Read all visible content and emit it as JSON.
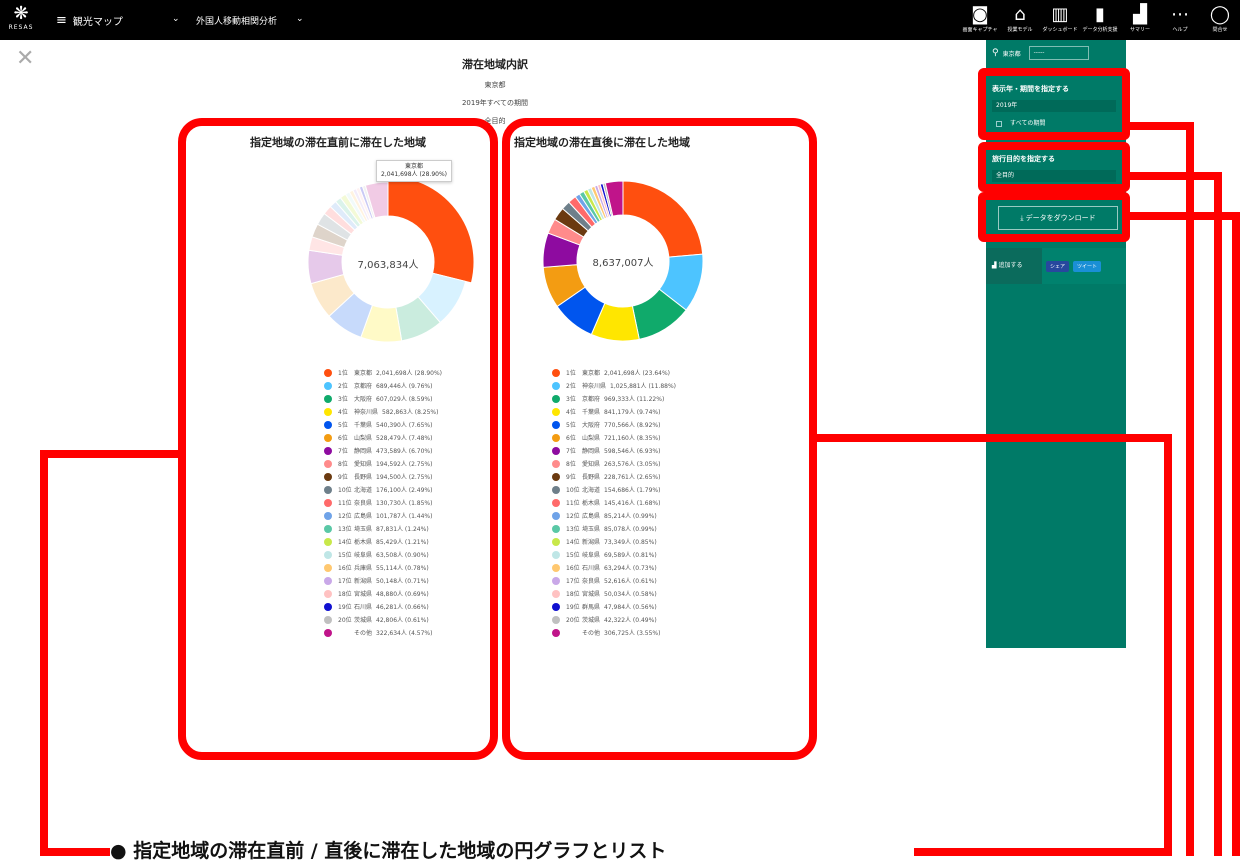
{
  "app": {
    "logo_text": "RESAS",
    "menu_label": "観光マップ",
    "submenu_label": "外国人移動相関分析"
  },
  "toolbar": [
    {
      "icon": "camera-icon",
      "label": "画面キャプチャ"
    },
    {
      "icon": "bank-icon",
      "label": "授業モデル"
    },
    {
      "icon": "dashboard-icon",
      "label": "ダッシュボード"
    },
    {
      "icon": "chart-icon",
      "label": "データ分析支援"
    },
    {
      "icon": "summary-icon",
      "label": "サマリー"
    },
    {
      "icon": "more-icon",
      "label": "ヘルプ"
    },
    {
      "icon": "chat-icon",
      "label": "問合せ"
    }
  ],
  "header": {
    "title": "滞在地域内訳",
    "pref": "東京都",
    "period": "2019年すべての期間",
    "purpose": "全目的"
  },
  "left": {
    "title": "指定地域の滞在直前に滞在した地域",
    "total": "7,063,834人",
    "tooltip": {
      "name": "東京都",
      "value": "2,041,698人 (28.90%)"
    },
    "items": [
      {
        "rank": "1位",
        "pref": "東京都",
        "val": "2,041,698人 (28.90%)",
        "color": "#ff4f0f"
      },
      {
        "rank": "2位",
        "pref": "京都府",
        "val": "689,446人 (9.76%)",
        "color": "#4dc4ff"
      },
      {
        "rank": "3位",
        "pref": "大阪府",
        "val": "607,029人 (8.59%)",
        "color": "#10aa6b"
      },
      {
        "rank": "4位",
        "pref": "神奈川県",
        "val": "582,863人 (8.25%)",
        "color": "#ffe600"
      },
      {
        "rank": "5位",
        "pref": "千葉県",
        "val": "540,390人 (7.65%)",
        "color": "#0055ee"
      },
      {
        "rank": "6位",
        "pref": "山梨県",
        "val": "528,479人 (7.48%)",
        "color": "#f39c12"
      },
      {
        "rank": "7位",
        "pref": "静岡県",
        "val": "473,589人 (6.70%)",
        "color": "#8e0ba0"
      },
      {
        "rank": "8位",
        "pref": "愛知県",
        "val": "194,592人 (2.75%)",
        "color": "#ff8b8b"
      },
      {
        "rank": "9位",
        "pref": "長野県",
        "val": "194,500人 (2.75%)",
        "color": "#6b3a10"
      },
      {
        "rank": "10位",
        "pref": "北海道",
        "val": "176,100人 (2.49%)",
        "color": "#6e7f8a"
      },
      {
        "rank": "11位",
        "pref": "奈良県",
        "val": "130,730人 (1.85%)",
        "color": "#ff6a6a"
      },
      {
        "rank": "12位",
        "pref": "広島県",
        "val": "101,787人 (1.44%)",
        "color": "#6fa3e8"
      },
      {
        "rank": "13位",
        "pref": "埼玉県",
        "val": "87,831人 (1.24%)",
        "color": "#5ac8a6"
      },
      {
        "rank": "14位",
        "pref": "栃木県",
        "val": "85,429人 (1.21%)",
        "color": "#c8e84a"
      },
      {
        "rank": "15位",
        "pref": "岐阜県",
        "val": "63,508人 (0.90%)",
        "color": "#bfe6e6"
      },
      {
        "rank": "16位",
        "pref": "兵庫県",
        "val": "55,114人 (0.78%)",
        "color": "#ffc870"
      },
      {
        "rank": "17位",
        "pref": "新潟県",
        "val": "50,148人 (0.71%)",
        "color": "#c9a8e8"
      },
      {
        "rank": "18位",
        "pref": "宮城県",
        "val": "48,880人 (0.69%)",
        "color": "#ffc2c2"
      },
      {
        "rank": "19位",
        "pref": "石川県",
        "val": "46,281人 (0.66%)",
        "color": "#1010d0"
      },
      {
        "rank": "20位",
        "pref": "茨城県",
        "val": "42,806人 (0.61%)",
        "color": "#c0c0c0"
      },
      {
        "rank": "",
        "pref": "その他",
        "val": "322,634人 (4.57%)",
        "color": "#c0148a"
      }
    ]
  },
  "right": {
    "title": "指定地域の滞在直後に滞在した地域",
    "total": "8,637,007人",
    "items": [
      {
        "rank": "1位",
        "pref": "東京都",
        "val": "2,041,698人 (23.64%)",
        "color": "#ff4f0f"
      },
      {
        "rank": "2位",
        "pref": "神奈川県",
        "val": "1,025,881人 (11.88%)",
        "color": "#4dc4ff"
      },
      {
        "rank": "3位",
        "pref": "京都府",
        "val": "969,333人 (11.22%)",
        "color": "#10aa6b"
      },
      {
        "rank": "4位",
        "pref": "千葉県",
        "val": "841,179人 (9.74%)",
        "color": "#ffe600"
      },
      {
        "rank": "5位",
        "pref": "大阪府",
        "val": "770,566人 (8.92%)",
        "color": "#0055ee"
      },
      {
        "rank": "6位",
        "pref": "山梨県",
        "val": "721,160人 (8.35%)",
        "color": "#f39c12"
      },
      {
        "rank": "7位",
        "pref": "静岡県",
        "val": "598,546人 (6.93%)",
        "color": "#8e0ba0"
      },
      {
        "rank": "8位",
        "pref": "愛知県",
        "val": "263,576人 (3.05%)",
        "color": "#ff8b8b"
      },
      {
        "rank": "9位",
        "pref": "長野県",
        "val": "228,761人 (2.65%)",
        "color": "#6b3a10"
      },
      {
        "rank": "10位",
        "pref": "北海道",
        "val": "154,686人 (1.79%)",
        "color": "#6e7f8a"
      },
      {
        "rank": "11位",
        "pref": "栃木県",
        "val": "145,416人 (1.68%)",
        "color": "#ff6a6a"
      },
      {
        "rank": "12位",
        "pref": "広島県",
        "val": "85,214人 (0.99%)",
        "color": "#6fa3e8"
      },
      {
        "rank": "13位",
        "pref": "埼玉県",
        "val": "85,078人 (0.99%)",
        "color": "#5ac8a6"
      },
      {
        "rank": "14位",
        "pref": "新潟県",
        "val": "73,349人 (0.85%)",
        "color": "#c8e84a"
      },
      {
        "rank": "15位",
        "pref": "岐阜県",
        "val": "69,589人 (0.81%)",
        "color": "#bfe6e6"
      },
      {
        "rank": "16位",
        "pref": "石川県",
        "val": "63,294人 (0.73%)",
        "color": "#ffc870"
      },
      {
        "rank": "17位",
        "pref": "奈良県",
        "val": "52,616人 (0.61%)",
        "color": "#c9a8e8"
      },
      {
        "rank": "18位",
        "pref": "宮城県",
        "val": "50,034人 (0.58%)",
        "color": "#ffc2c2"
      },
      {
        "rank": "19位",
        "pref": "群馬県",
        "val": "47,984人 (0.56%)",
        "color": "#1010d0"
      },
      {
        "rank": "20位",
        "pref": "茨城県",
        "val": "42,322人 (0.49%)",
        "color": "#c0c0c0"
      },
      {
        "rank": "",
        "pref": "その他",
        "val": "306,725人 (3.55%)",
        "color": "#c0148a"
      }
    ]
  },
  "sidebar": {
    "pref": "東京都",
    "city": "-----",
    "year_header": "表示年・期間を指定する",
    "year": "2019年",
    "period": "すべての期間",
    "purpose_header": "旅行目的を指定する",
    "purpose": "全目的",
    "download": "データをダウンロード",
    "add": "追加する",
    "share": "シェア",
    "tweet": "ツイート"
  },
  "annotation": "● 指定地域の滞在直前 / 直後に滞在した地域の円グラフとリスト",
  "chart_data": [
    {
      "type": "pie",
      "title": "指定地域の滞在直前に滞在した地域",
      "total": "7,063,834人",
      "categories": [
        "東京都",
        "京都府",
        "大阪府",
        "神奈川県",
        "千葉県",
        "山梨県",
        "静岡県",
        "愛知県",
        "長野県",
        "北海道",
        "奈良県",
        "広島県",
        "埼玉県",
        "栃木県",
        "岐阜県",
        "兵庫県",
        "新潟県",
        "宮城県",
        "石川県",
        "茨城県",
        "その他"
      ],
      "values": [
        28.9,
        9.76,
        8.59,
        8.25,
        7.65,
        7.48,
        6.7,
        2.75,
        2.75,
        2.49,
        1.85,
        1.44,
        1.24,
        1.21,
        0.9,
        0.78,
        0.71,
        0.69,
        0.66,
        0.61,
        4.57
      ],
      "highlight": 0
    },
    {
      "type": "pie",
      "title": "指定地域の滞在直後に滞在した地域",
      "total": "8,637,007人",
      "categories": [
        "東京都",
        "神奈川県",
        "京都府",
        "千葉県",
        "大阪府",
        "山梨県",
        "静岡県",
        "愛知県",
        "長野県",
        "北海道",
        "栃木県",
        "広島県",
        "埼玉県",
        "新潟県",
        "岐阜県",
        "石川県",
        "奈良県",
        "宮城県",
        "群馬県",
        "茨城県",
        "その他"
      ],
      "values": [
        23.64,
        11.88,
        11.22,
        9.74,
        8.92,
        8.35,
        6.93,
        3.05,
        2.65,
        1.79,
        1.68,
        0.99,
        0.99,
        0.85,
        0.81,
        0.73,
        0.61,
        0.58,
        0.56,
        0.49,
        3.55
      ],
      "highlight": -1
    }
  ]
}
